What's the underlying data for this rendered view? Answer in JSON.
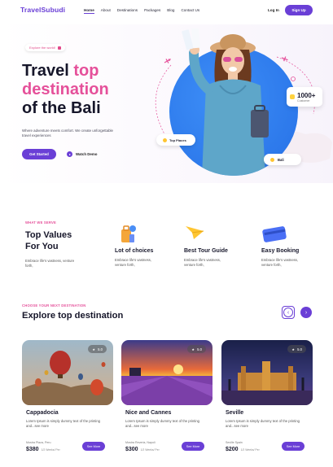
{
  "brand": {
    "logo": "TravelSubudi",
    "accent": "#6a3fd6",
    "pink": "#e5509a"
  },
  "nav": {
    "links": [
      "Home",
      "About",
      "Destinations",
      "Packages",
      "Blog",
      "Contact Us"
    ],
    "login": "Log In",
    "signup": "Sign Up"
  },
  "hero": {
    "pill": "Explore the world!",
    "title_line1_a": "Travel ",
    "title_line1_b": "top",
    "title_line2": "destination",
    "title_line3": "of the Bali",
    "description": "Where adventure meets comfort. We create unforgettable travel experiences",
    "cta_primary": "Get Started",
    "cta_secondary": "Watch Demo",
    "badge_customers_num": "1000+",
    "badge_customers_label": "Customer",
    "badge_top": "Top Places",
    "badge_place": "Bali"
  },
  "values": {
    "label": "WHAT WE SERVE",
    "title_line1": "Top Values",
    "title_line2": "For You",
    "description": "Embrace life's vastness, venture forth,",
    "features": [
      {
        "title": "Lot of choices",
        "desc": "Embrace life's vastness, venture forth,"
      },
      {
        "title": "Best Tour Guide",
        "desc": "Embrace life's vastness, venture forth,"
      },
      {
        "title": "Easy Booking",
        "desc": "Embrace life's vastness, venture forth,"
      }
    ]
  },
  "explore": {
    "label": "CHOOSE YOUR NEXT DESTINATION",
    "title": "Explore top destination",
    "cards": [
      {
        "title": "Cappadocia",
        "rating": "5.0",
        "desc": "Lorem Ipsum is simply dummy text of the printing and...see more",
        "location": "Mostra Plaza, Peru",
        "price": "$380",
        "price_note": "1/2 Weeks/ Per",
        "more": "See More"
      },
      {
        "title": "Nice and Cannes",
        "rating": "5.0",
        "desc": "Lorem Ipsum is simply dummy text of the printing and...see more",
        "location": "Mostra Reveria, Napoli",
        "price": "$300",
        "price_note": "1/2 Weeks/ Per",
        "more": "See More"
      },
      {
        "title": "Seville",
        "rating": "5.0",
        "desc": "Lorem Ipsum is simply dummy text of the printing and...see more",
        "location": "Seville Spain",
        "price": "$200",
        "price_note": "1/2 Weeks/ Per",
        "more": "See More"
      }
    ]
  }
}
